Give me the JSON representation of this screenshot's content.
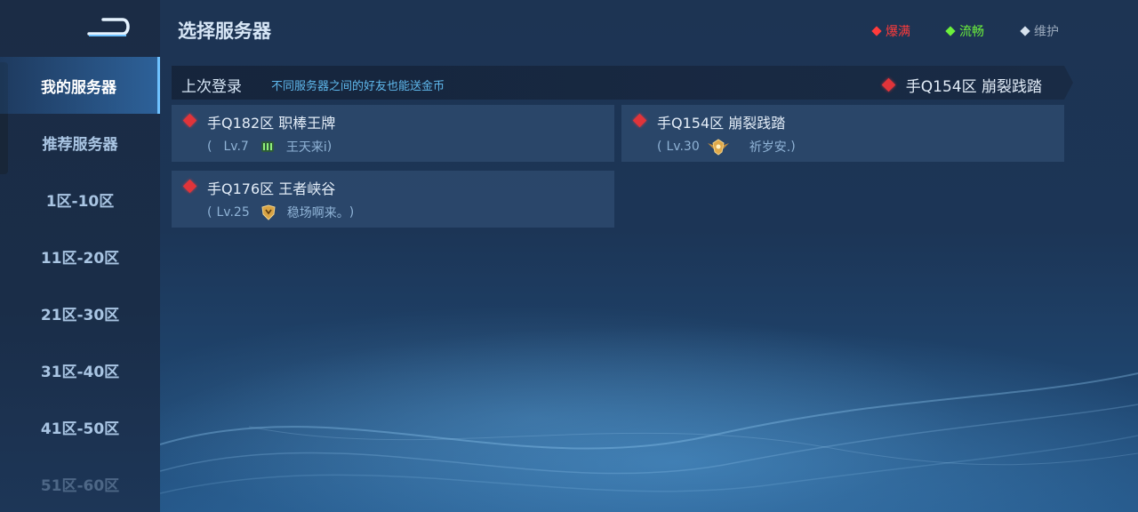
{
  "header": {
    "title": "选择服务器"
  },
  "legend": [
    {
      "label": "爆满",
      "color": "#ff3b3b"
    },
    {
      "label": "流畅",
      "color": "#6cf03c"
    },
    {
      "label": "维护",
      "color": "#9aa9bc"
    }
  ],
  "sidebar": {
    "items": [
      {
        "label": "我的服务器",
        "active": true
      },
      {
        "label": "推荐服务器"
      },
      {
        "label": "1区-10区"
      },
      {
        "label": "11区-20区"
      },
      {
        "label": "21区-30区"
      },
      {
        "label": "31区-40区"
      },
      {
        "label": "41区-50区"
      },
      {
        "label": "51区-60区"
      }
    ]
  },
  "last_login": {
    "label": "上次登录",
    "hint": "不同服务器之间的好友也能送金币",
    "server": "手Q154区 崩裂践踏"
  },
  "servers": [
    {
      "name": "手Q182区 职棒王牌",
      "open": "(",
      "level": "Lv.7",
      "rank_icon": "rank-green-icon",
      "player": "王天来i",
      "close": ")"
    },
    {
      "name": "手Q154区 崩裂践踏",
      "open": "(",
      "level": "Lv.30",
      "rank_icon": "rank-gold-wings-icon",
      "player": "祈岁安.",
      "close": ")"
    },
    {
      "name": "手Q176区 王者峡谷",
      "open": "(",
      "level": "Lv.25",
      "rank_icon": "rank-gold-shield-icon",
      "player": "稳场啊来。",
      "close": ")"
    }
  ],
  "status_color": "#e0343a"
}
